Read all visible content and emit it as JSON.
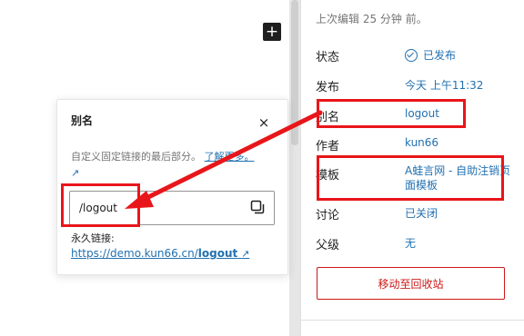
{
  "canvas": {
    "add_symbol": "+"
  },
  "sidebar": {
    "last_edited": "上次编辑 25 分钟 前。",
    "rows": {
      "status": {
        "label": "状态",
        "value": "已发布"
      },
      "publish": {
        "label": "发布",
        "value": "今天 上午11:32"
      },
      "slug": {
        "label": "别名",
        "value": "logout"
      },
      "author": {
        "label": "作者",
        "value": "kun66"
      },
      "template": {
        "label": "模板",
        "value": "A蛙言网 - 自助注销页面模板"
      },
      "discussion": {
        "label": "讨论",
        "value": "已关闭"
      },
      "parent": {
        "label": "父级",
        "value": "无"
      }
    },
    "trash_label": "移动至回收站"
  },
  "popover": {
    "title": "别名",
    "close_symbol": "×",
    "help_text": "自定义固定链接的最后部分。",
    "learn_more": "了解更多。",
    "external_symbol": "↗",
    "slug_value": "/logout",
    "permalink_label": "永久链接:",
    "permalink_prefix": "https://demo.kun66.cn/",
    "permalink_slug": "logout"
  },
  "colors": {
    "accent": "#2271b1",
    "annotation": "#e8161a",
    "danger": "#cc1818"
  },
  "icons": {
    "status": "check-circle-icon",
    "copy": "copy-icon",
    "close": "close-icon",
    "external": "external-link-icon",
    "add": "plus-icon"
  }
}
